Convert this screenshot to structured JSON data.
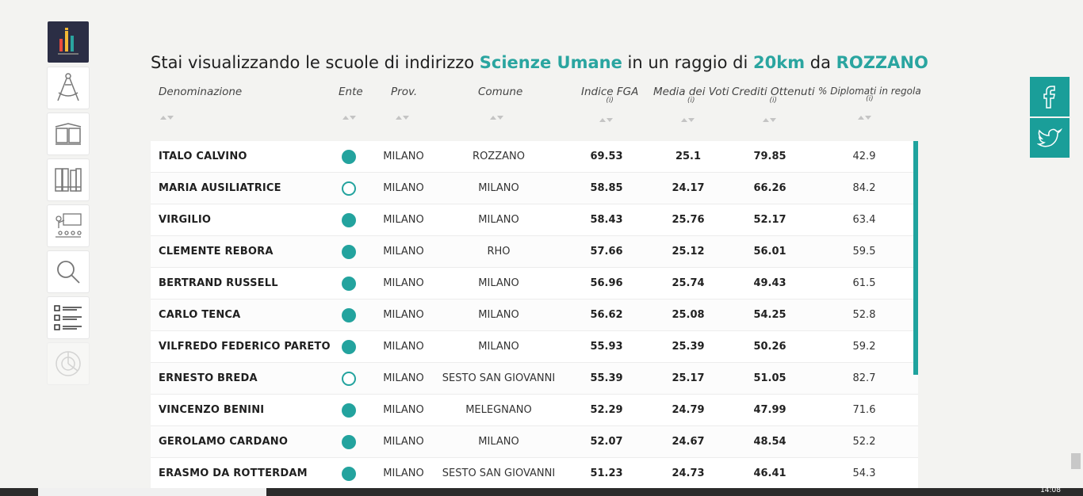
{
  "title": {
    "prefix": "Stai visualizzando le scuole di indirizzo",
    "indirizzo": "Scienze Umane",
    "middle": "in un raggio di",
    "radius": "20km",
    "da": "da",
    "city": "ROZZANO"
  },
  "headers": {
    "denominazione": "Denominazione",
    "ente": "Ente",
    "prov": "Prov.",
    "comune": "Comune",
    "fga": "Indice FGA",
    "media": "Media dei Voti",
    "crediti": "Crediti Ottenuti",
    "diplomati": "% Diplomati in regola",
    "info": "(i)"
  },
  "rows": [
    {
      "name": "ITALO CALVINO",
      "ente": "pub",
      "prov": "MILANO",
      "comune": "ROZZANO",
      "fga": "69.53",
      "media": "25.1",
      "crediti": "79.85",
      "dip": "42.9"
    },
    {
      "name": "MARIA AUSILIATRICE",
      "ente": "priv",
      "prov": "MILANO",
      "comune": "MILANO",
      "fga": "58.85",
      "media": "24.17",
      "crediti": "66.26",
      "dip": "84.2"
    },
    {
      "name": "VIRGILIO",
      "ente": "pub",
      "prov": "MILANO",
      "comune": "MILANO",
      "fga": "58.43",
      "media": "25.76",
      "crediti": "52.17",
      "dip": "63.4"
    },
    {
      "name": "CLEMENTE REBORA",
      "ente": "pub",
      "prov": "MILANO",
      "comune": "RHO",
      "fga": "57.66",
      "media": "25.12",
      "crediti": "56.01",
      "dip": "59.5"
    },
    {
      "name": "BERTRAND RUSSELL",
      "ente": "pub",
      "prov": "MILANO",
      "comune": "MILANO",
      "fga": "56.96",
      "media": "25.74",
      "crediti": "49.43",
      "dip": "61.5"
    },
    {
      "name": "CARLO TENCA",
      "ente": "pub",
      "prov": "MILANO",
      "comune": "MILANO",
      "fga": "56.62",
      "media": "25.08",
      "crediti": "54.25",
      "dip": "52.8"
    },
    {
      "name": "VILFREDO FEDERICO PARETO",
      "ente": "pub",
      "prov": "MILANO",
      "comune": "MILANO",
      "fga": "55.93",
      "media": "25.39",
      "crediti": "50.26",
      "dip": "59.2"
    },
    {
      "name": "ERNESTO BREDA",
      "ente": "priv",
      "prov": "MILANO",
      "comune": "SESTO SAN GIOVANNI",
      "fga": "55.39",
      "media": "25.17",
      "crediti": "51.05",
      "dip": "82.7"
    },
    {
      "name": "VINCENZO BENINI",
      "ente": "pub",
      "prov": "MILANO",
      "comune": "MELEGNANO",
      "fga": "52.29",
      "media": "24.79",
      "crediti": "47.99",
      "dip": "71.6"
    },
    {
      "name": "GEROLAMO CARDANO",
      "ente": "pub",
      "prov": "MILANO",
      "comune": "MILANO",
      "fga": "52.07",
      "media": "24.67",
      "crediti": "48.54",
      "dip": "52.2"
    },
    {
      "name": "ERASMO DA ROTTERDAM",
      "ente": "pub",
      "prov": "MILANO",
      "comune": "SESTO SAN GIOVANNI",
      "fga": "51.23",
      "media": "24.73",
      "crediti": "46.41",
      "dip": "54.3"
    }
  ],
  "sidebar": [
    "ranking-icon",
    "compass-icon",
    "open-book-icon",
    "books-icon",
    "classroom-icon",
    "search-icon",
    "list-icon",
    "chart-disabled-icon"
  ],
  "colors": {
    "accent": "#2aa5a0",
    "sidebar_active": "#2b2e45",
    "social": "#1a9e99"
  },
  "clock": "14:08"
}
